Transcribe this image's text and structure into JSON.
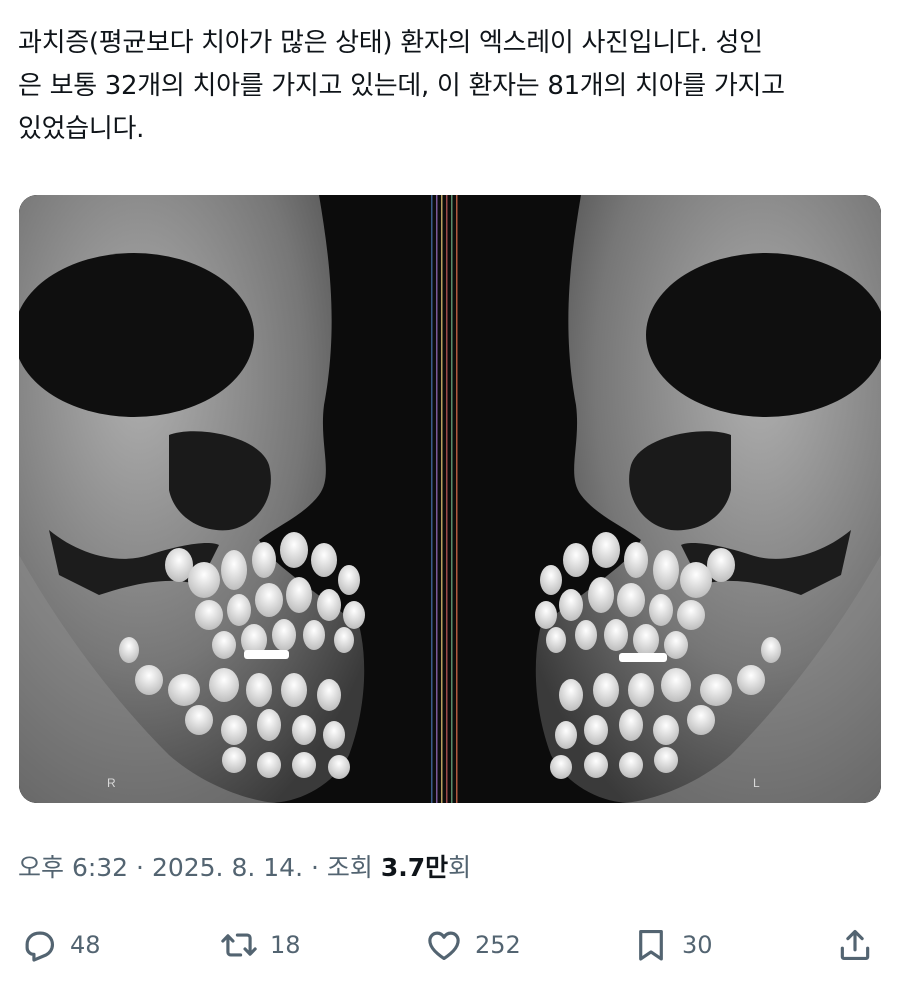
{
  "post": {
    "text": "과치증(평균보다 치아가 많은 상태) 환자의 엑스레이 사진입니다. 성인\n은 보통 32개의 치아를 가지고 있는데, 이 환자는 81개의 치아를 가지고\n있었습니다."
  },
  "media": {
    "left_marker": "R",
    "right_marker": "L"
  },
  "meta": {
    "time": "오후 6:32",
    "separator1": " · ",
    "date": "2025. 8. 14.",
    "separator2": " · ",
    "views_prefix": "조회 ",
    "views_number": "3.7",
    "views_unit": "만",
    "views_suffix": "회"
  },
  "actions": {
    "replies": "48",
    "reposts": "18",
    "likes": "252",
    "bookmarks": "30"
  },
  "colors": {
    "text": "#0f1419",
    "muted": "#536471",
    "xray_background": "#0c0c0c"
  },
  "icons": [
    "reply-icon",
    "repost-icon",
    "like-icon",
    "bookmark-icon",
    "share-icon"
  ]
}
